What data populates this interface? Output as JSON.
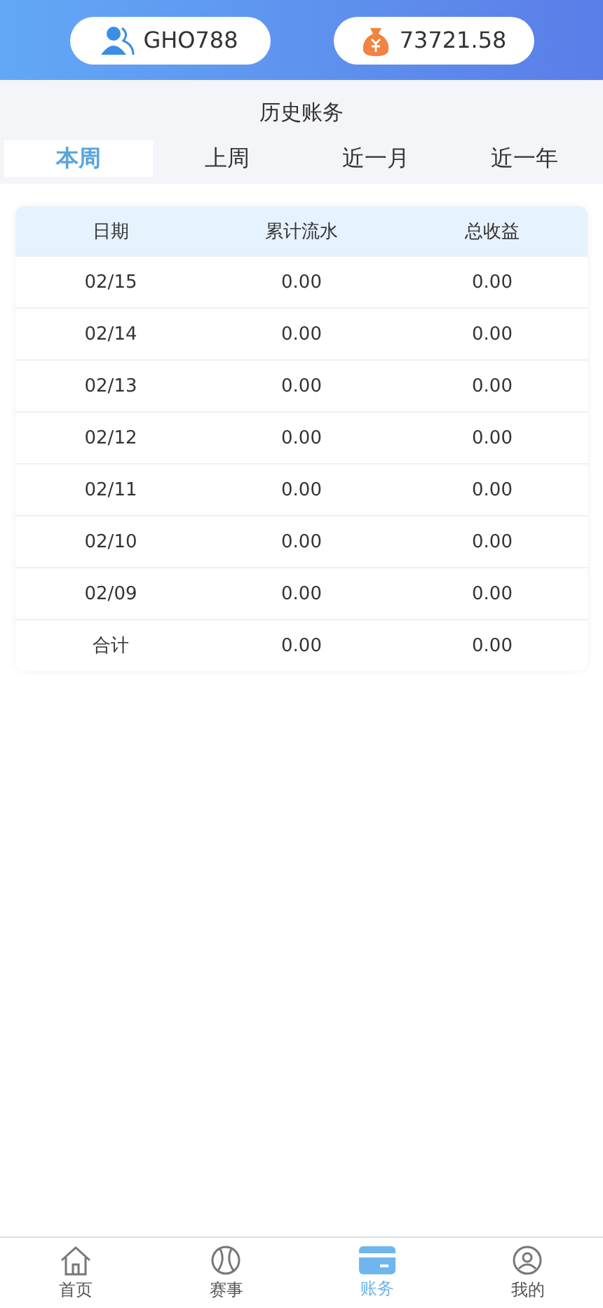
{
  "header": {
    "username": "GHO788",
    "balance": "73721.58"
  },
  "title": "历史账务",
  "tabs": [
    {
      "label": "本周",
      "selected": true
    },
    {
      "label": "上周",
      "selected": false
    },
    {
      "label": "近一月",
      "selected": false
    },
    {
      "label": "近一年",
      "selected": false
    }
  ],
  "table": {
    "columns": [
      "日期",
      "累计流水",
      "总收益"
    ],
    "rows": [
      [
        "02/15",
        "0.00",
        "0.00"
      ],
      [
        "02/14",
        "0.00",
        "0.00"
      ],
      [
        "02/13",
        "0.00",
        "0.00"
      ],
      [
        "02/12",
        "0.00",
        "0.00"
      ],
      [
        "02/11",
        "0.00",
        "0.00"
      ],
      [
        "02/10",
        "0.00",
        "0.00"
      ],
      [
        "02/09",
        "0.00",
        "0.00"
      ],
      [
        "合计",
        "0.00",
        "0.00"
      ]
    ]
  },
  "nav": [
    {
      "label": "首页",
      "kind": "home",
      "selected": false
    },
    {
      "label": "赛事",
      "kind": "ball",
      "selected": false
    },
    {
      "label": "账务",
      "kind": "card",
      "selected": true
    },
    {
      "label": "我的",
      "kind": "user",
      "selected": false
    }
  ]
}
